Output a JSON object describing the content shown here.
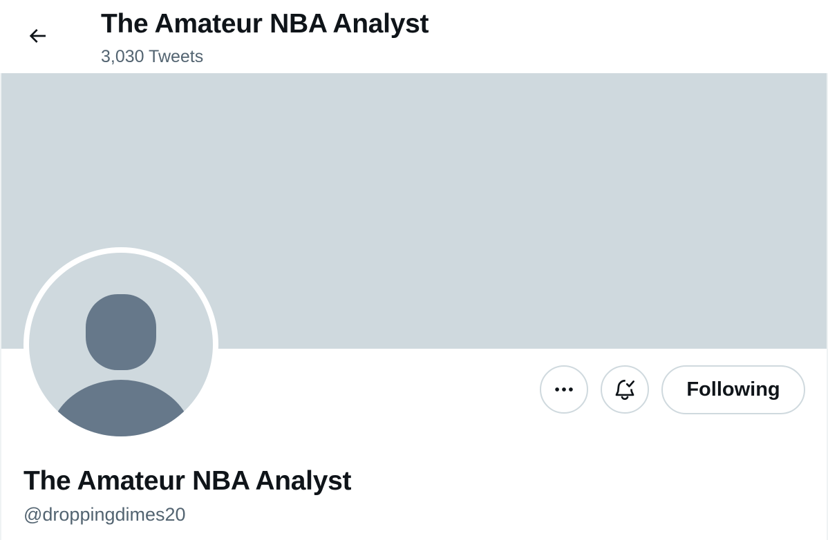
{
  "header": {
    "title": "The Amateur NBA Analyst",
    "tweet_count": "3,030 Tweets",
    "back_icon": "arrow-left-icon"
  },
  "banner": {
    "color": "#cfd9de"
  },
  "avatar": {
    "icon": "default-avatar-icon",
    "background": "#cfd9de",
    "silhouette": "#66788a"
  },
  "actions": {
    "more_icon": "more-horizontal-icon",
    "notifications_icon": "bell-check-icon",
    "following_label": "Following"
  },
  "profile": {
    "display_name": "The Amateur NBA Analyst",
    "handle": "@droppingdimes20"
  },
  "colors": {
    "text_primary": "#0f1419",
    "text_secondary": "#536471",
    "border": "#cfd9de"
  }
}
